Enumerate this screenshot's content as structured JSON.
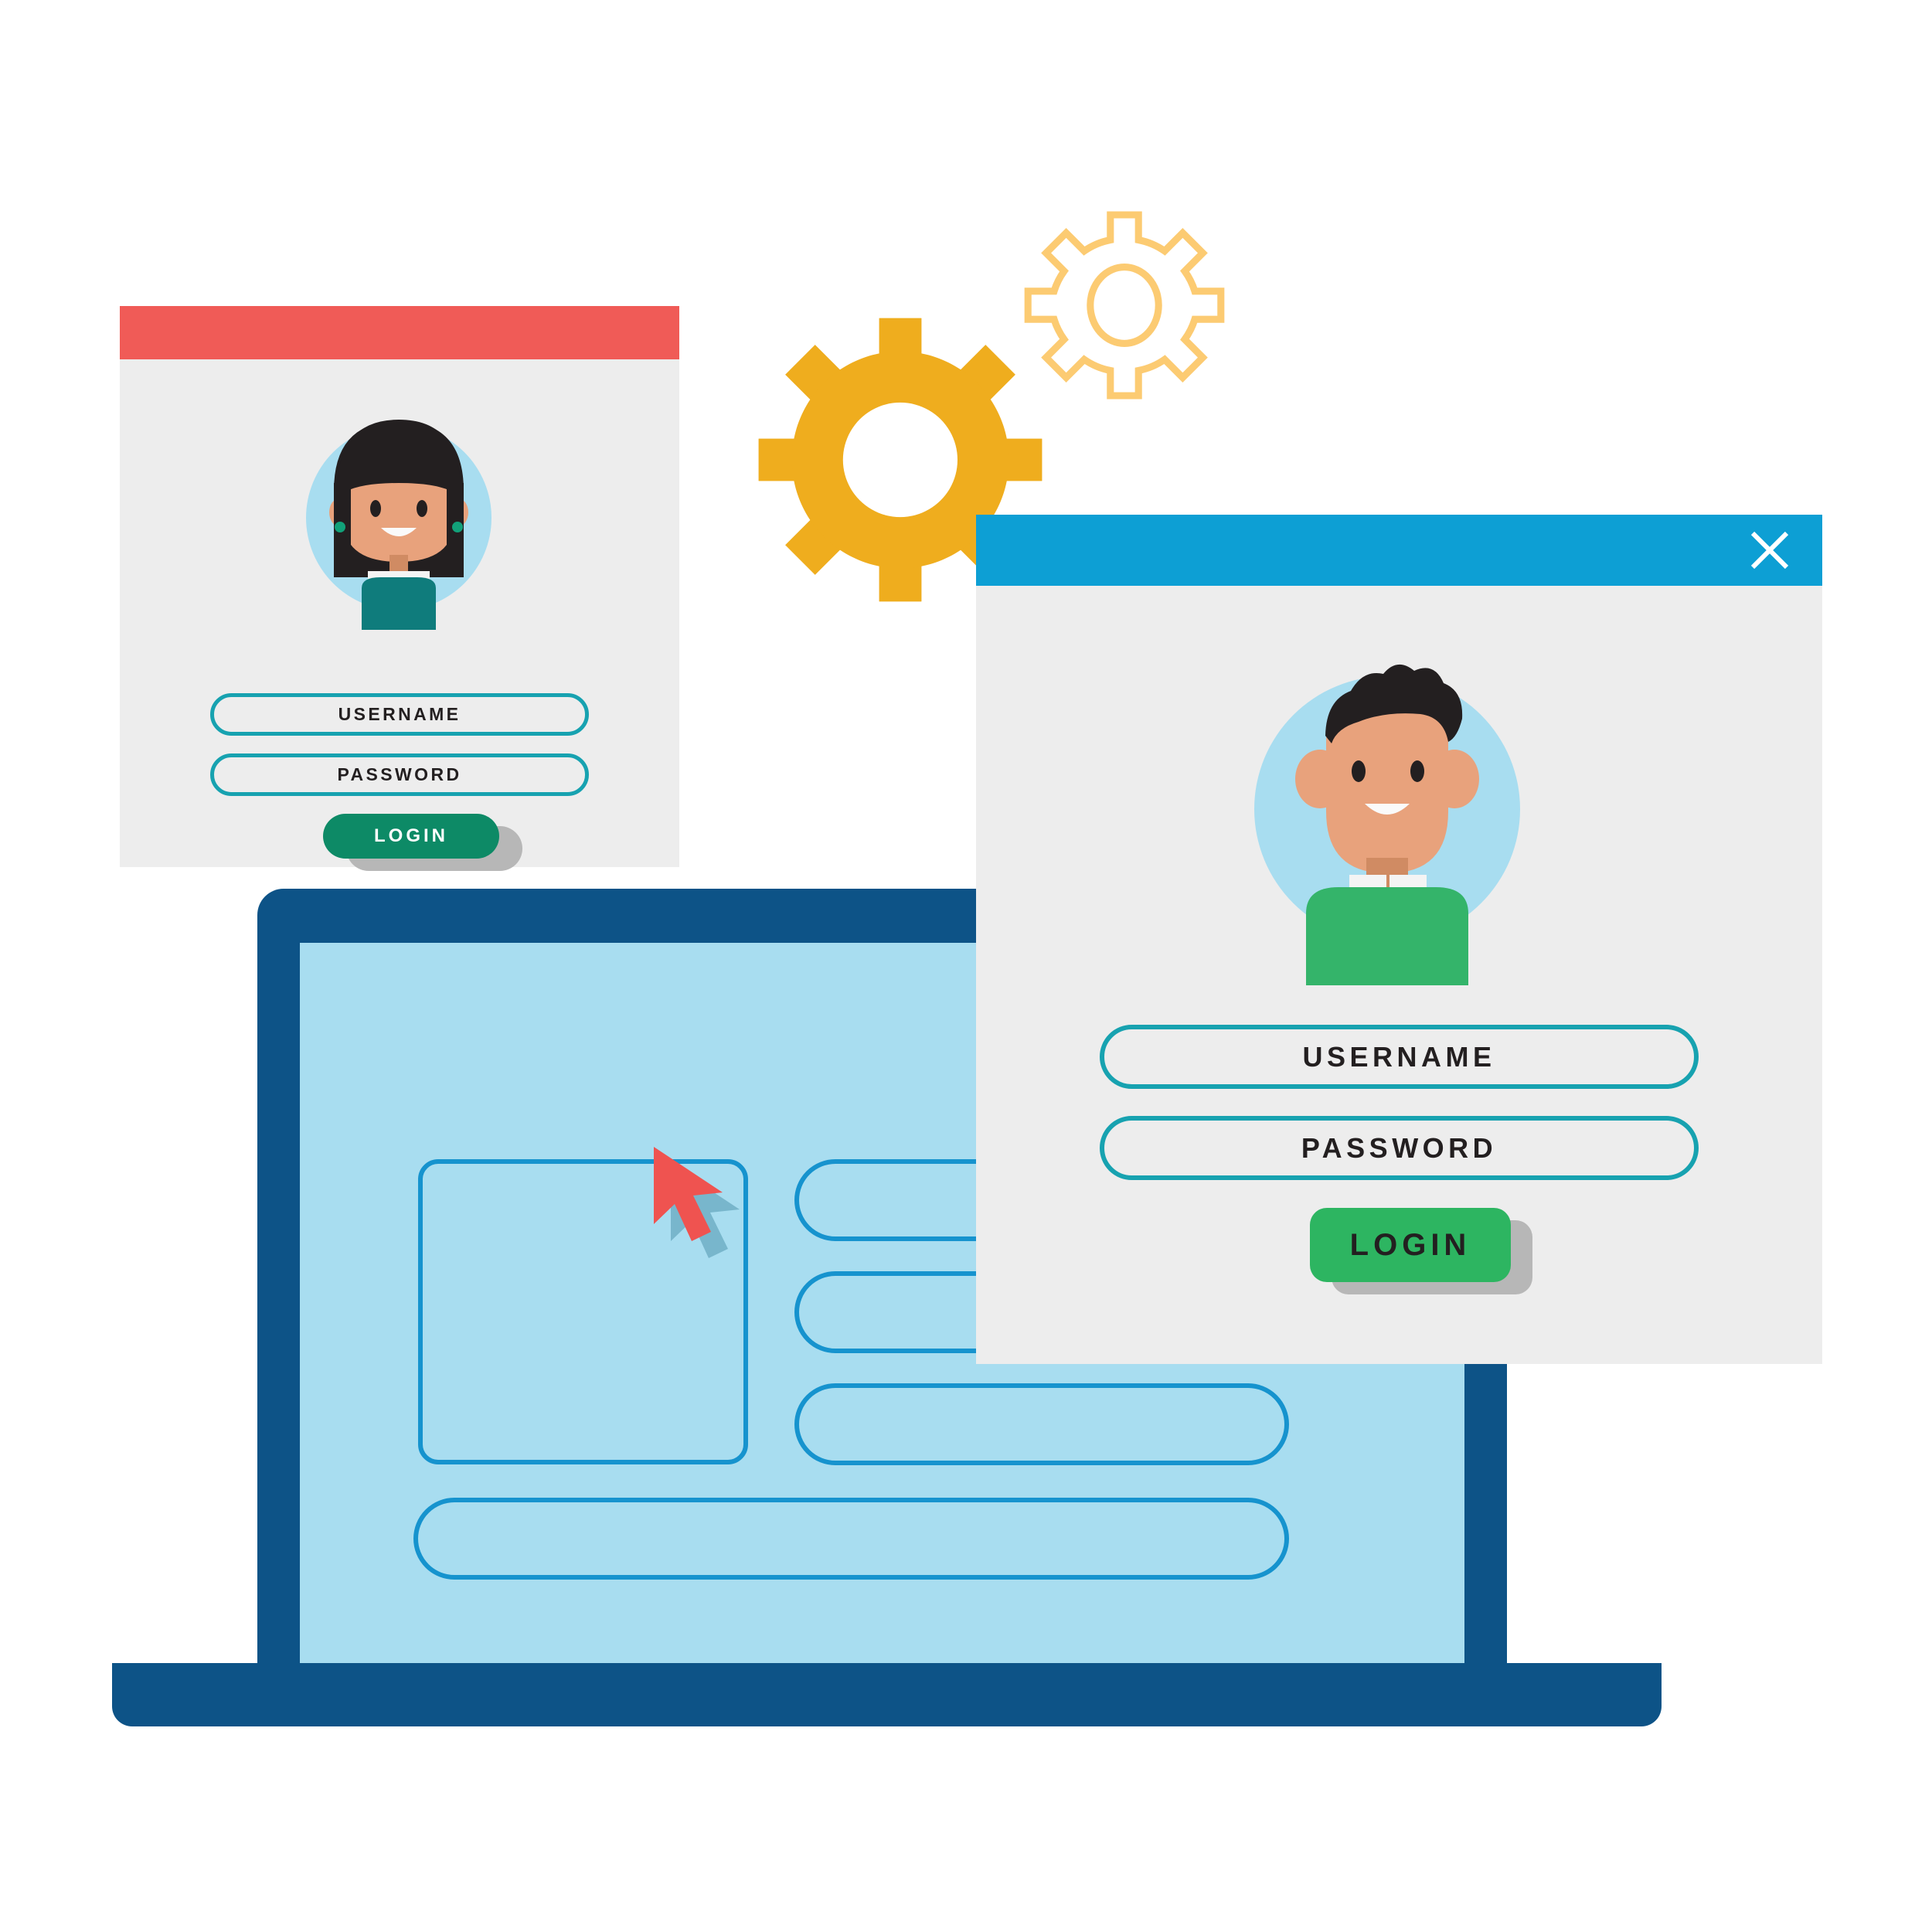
{
  "scene": {
    "title": "Login windows with gears and laptop illustration",
    "background_color": "#FFFFFF"
  },
  "palette": {
    "red_titlebar": "#F05B57",
    "blue_titlebar": "#0D9FD4",
    "window_body": "#EDEDED",
    "field_border_teal": "#17A2B0",
    "button_green_dark": "#0D8A66",
    "button_green_light": "#2DB561",
    "button_shadow_gray": "#B7B7B7",
    "laptop_navy": "#0D5387",
    "laptop_screen_blue": "#A8DDF0",
    "wireframe_blue": "#1693CE",
    "gear_solid_yellow": "#EFAD1E",
    "gear_outline_yellow": "#FCCB72",
    "cursor_red": "#EF5350",
    "skin": "#E8A27C",
    "hair_black": "#231F20",
    "avatar_circle_blue": "#A8DDF0",
    "shirt_teal": "#0F7C7C",
    "shirt_green": "#34B46A",
    "text_dark": "#231F20",
    "text_white": "#FFFFFF"
  },
  "small_window": {
    "name": "Login window (back)",
    "titlebar": {
      "color": "#F05B57",
      "label": ""
    },
    "avatar": {
      "icon": "user-avatar-female",
      "hair": "black-bob",
      "shirt_color": "#0F7C7C",
      "earrings": "green-studs",
      "circle_color": "#A8DDF0"
    },
    "fields": [
      {
        "name": "username",
        "value": "USERNAME",
        "placeholder": "USERNAME"
      },
      {
        "name": "password",
        "value": "PASSWORD",
        "placeholder": "PASSWORD"
      }
    ],
    "login_button": {
      "label": "LOGIN",
      "fill": "#0D8A66",
      "text_color": "#FFFFFF"
    }
  },
  "large_window": {
    "name": "Login window (front)",
    "titlebar": {
      "color": "#0D9FD4",
      "label": "",
      "close_icon": "close-x-icon"
    },
    "avatar": {
      "icon": "user-avatar-male",
      "hair": "black-wavy",
      "shirt_color": "#34B46A",
      "collar": "white",
      "circle_color": "#A8DDF0"
    },
    "fields": [
      {
        "name": "username",
        "value": "USERNAME",
        "placeholder": "USERNAME"
      },
      {
        "name": "password",
        "value": "PASSWORD",
        "placeholder": "PASSWORD"
      }
    ],
    "login_button": {
      "label": "LOGIN",
      "fill": "#2DB561",
      "text_color": "#231F20"
    }
  },
  "laptop": {
    "name": "laptop-mockup",
    "bezel_color": "#0D5387",
    "screen_color": "#A8DDF0",
    "wireframe": {
      "stroke": "#1693CE",
      "items": [
        {
          "name": "image-placeholder-square",
          "shape": "rounded-square"
        },
        {
          "name": "text-line-1",
          "shape": "pill"
        },
        {
          "name": "text-line-2",
          "shape": "pill"
        },
        {
          "name": "text-line-3",
          "shape": "pill"
        },
        {
          "name": "text-line-wide",
          "shape": "pill"
        }
      ]
    },
    "cursor": {
      "icon": "mouse-pointer-icon",
      "color": "#EF5350",
      "has_shadow": true
    }
  },
  "gears": [
    {
      "name": "gear-solid",
      "icon": "gear-icon",
      "style": "filled",
      "teeth": 8,
      "color": "#EFAD1E"
    },
    {
      "name": "gear-outline",
      "icon": "gear-icon",
      "style": "outline",
      "teeth": 8,
      "color": "#FCCB72"
    }
  ]
}
